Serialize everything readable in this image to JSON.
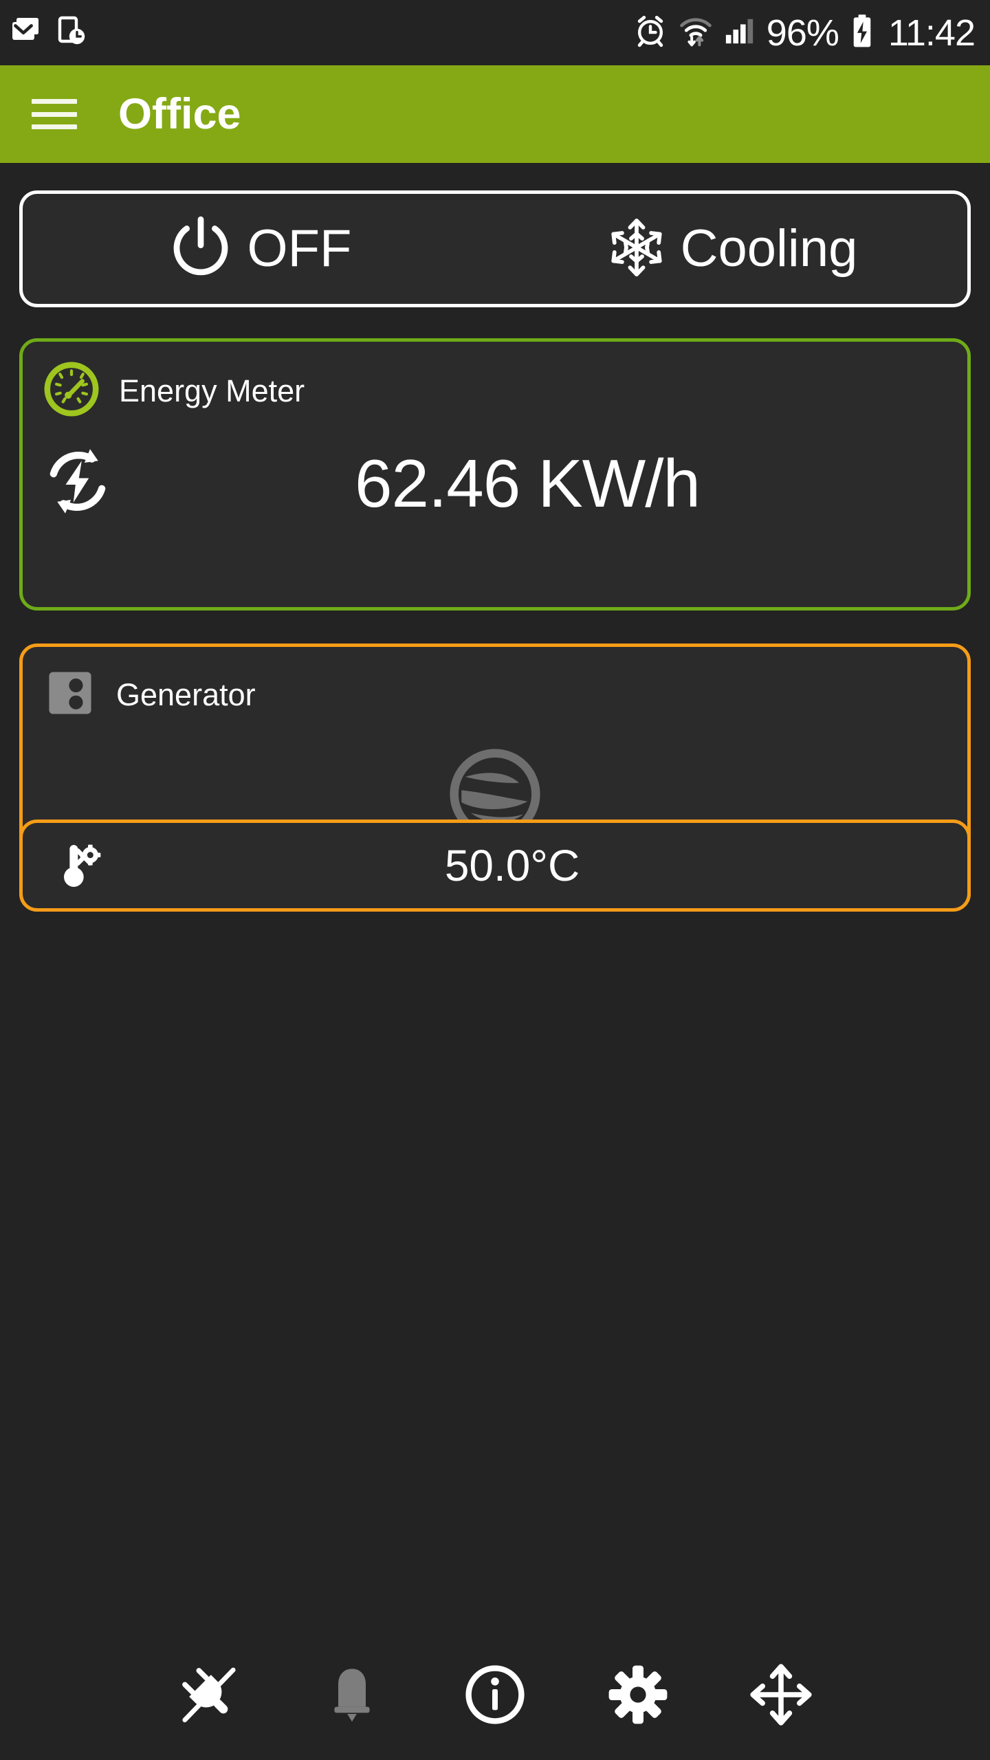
{
  "status_bar": {
    "left_icons": [
      {
        "name": "email-icon"
      },
      {
        "name": "device-clock-icon"
      }
    ],
    "right_icons": [
      {
        "name": "alarm-clock-icon"
      },
      {
        "name": "wifi-transfer-icon"
      },
      {
        "name": "cellular-signal-icon"
      },
      {
        "name": "battery-charging-icon"
      }
    ],
    "battery_percent": "96%",
    "clock": "11:42"
  },
  "app_bar": {
    "menu_icon": "hamburger-menu-icon",
    "title": "Office",
    "background_color": "#85a914",
    "title_color": "#ffffff"
  },
  "mode_bar": {
    "border_color": "#ffffff",
    "items": [
      {
        "icon": "power-icon",
        "label": "OFF"
      },
      {
        "icon": "snowflake-icon",
        "label": "Cooling"
      }
    ]
  },
  "cards": [
    {
      "id": "energy-meter",
      "title": "Energy Meter",
      "header_icon": "gauge-icon",
      "border_color": "#6fab18",
      "value_icon": "energy-cycle-icon",
      "value": "62.46 KW/h"
    },
    {
      "id": "generator",
      "title": "Generator",
      "header_icon": "generator-outlet-icon",
      "border_color": "#f59c18",
      "status_icon": "turbine-disabled-icon",
      "status_icon_color": "#6e6e6e",
      "temperature": {
        "icon": "thermometer-settings-icon",
        "value": "50.0°C",
        "border_color": "#f59c18"
      }
    }
  ],
  "toolbar": {
    "buttons": [
      {
        "name": "disconnected-plug-icon",
        "label": "Disconnected",
        "color": "#ffffff"
      },
      {
        "name": "bell-icon",
        "label": "Alarms",
        "color": "#7d7d7d"
      },
      {
        "name": "info-icon",
        "label": "Info",
        "color": "#ffffff"
      },
      {
        "name": "gear-icon",
        "label": "Settings",
        "color": "#ffffff"
      },
      {
        "name": "move-arrows-icon",
        "label": "Move",
        "color": "#ffffff"
      }
    ]
  },
  "theme": {
    "page_background": "#232323",
    "card_background": "#2b2b2b",
    "accent_green": "#85a914",
    "accent_orange": "#f59c18"
  }
}
